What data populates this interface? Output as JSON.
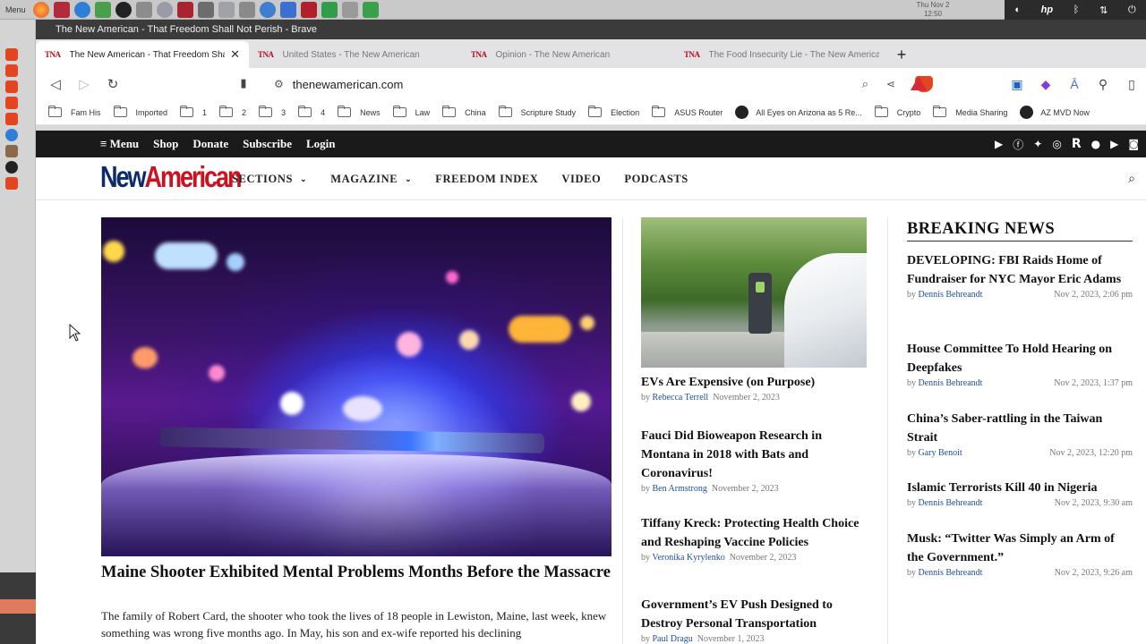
{
  "os": {
    "menu_label": "Menu",
    "clock_day": "Thu Nov 2",
    "clock_time": "12:50"
  },
  "window": {
    "title": "The New American - That Freedom Shall Not Perish - Brave"
  },
  "tabs": [
    {
      "label": "The New American - That Freedom Shall Not Perish - Brave",
      "active": true
    },
    {
      "label": "United States - The New American",
      "active": false
    },
    {
      "label": "Opinion - The New American",
      "active": false
    },
    {
      "label": "The Food Insecurity Lie - The New American",
      "active": false
    }
  ],
  "tab_favicon": "TNA",
  "address_bar": {
    "url": "thenewamerican.com"
  },
  "bookmarks": [
    {
      "label": "Fam His",
      "type": "folder"
    },
    {
      "label": "Imported",
      "type": "folder"
    },
    {
      "label": "1",
      "type": "folder"
    },
    {
      "label": "2",
      "type": "folder"
    },
    {
      "label": "3",
      "type": "folder"
    },
    {
      "label": "4",
      "type": "folder"
    },
    {
      "label": "News",
      "type": "folder"
    },
    {
      "label": "Law",
      "type": "folder"
    },
    {
      "label": "China",
      "type": "folder"
    },
    {
      "label": "Scripture Study",
      "type": "folder"
    },
    {
      "label": "Election",
      "type": "folder"
    },
    {
      "label": "ASUS Router",
      "type": "folder"
    },
    {
      "label": "All Eyes on Arizona as 5 Re...",
      "type": "site"
    },
    {
      "label": "Crypto",
      "type": "folder"
    },
    {
      "label": "Media Sharing",
      "type": "folder"
    },
    {
      "label": "AZ MVD Now",
      "type": "site"
    }
  ],
  "site": {
    "topbar_links": [
      "≡ Menu",
      "Shop",
      "Donate",
      "Subscribe",
      "Login"
    ],
    "logo_part1": "New",
    "logo_part2": "American",
    "nav": [
      {
        "label": "SECTIONS",
        "dropdown": true
      },
      {
        "label": "MAGAZINE",
        "dropdown": true
      },
      {
        "label": "FREEDOM INDEX",
        "dropdown": false
      },
      {
        "label": "VIDEO",
        "dropdown": false
      },
      {
        "label": "PODCASTS",
        "dropdown": false
      }
    ],
    "social_icons": [
      "rumble-icon",
      "facebook-icon",
      "twitter-icon",
      "instagram-icon",
      "r-icon",
      "apple-icon",
      "play-icon",
      "rss-icon"
    ]
  },
  "hero": {
    "title": "Maine Shooter Exhibited Mental Problems Months Before the Massacre",
    "text": "The family of Robert Card, the shooter who took the lives of 18 people in Lewiston, Maine, last week, knew something was wrong five months ago. In May, his son and ex-wife reported his declining"
  },
  "middle_articles": [
    {
      "title": "EVs Are Expensive (on Purpose)",
      "by": "by",
      "author": "Rebecca Terrell",
      "date": "November 2, 2023"
    },
    {
      "title": "Fauci Did Bioweapon Research in Montana in 2018 with Bats and Coronavirus!",
      "by": "by",
      "author": "Ben Armstrong",
      "date": "November 2, 2023"
    },
    {
      "title": "Tiffany Kreck: Protecting Health Choice and Reshaping Vaccine Policies",
      "by": "by",
      "author": "Veronika Kyrylenko",
      "date": "November 2, 2023"
    },
    {
      "title": "Government’s EV Push Designed to Destroy Personal Transportation",
      "by": "by",
      "author": "Paul Dragu",
      "date": "November 1, 2023"
    }
  ],
  "breaking": {
    "heading": "BREAKING NEWS",
    "items": [
      {
        "title": "DEVELOPING: FBI Raids Home of Fundraiser for NYC Mayor Eric Adams",
        "by": "by",
        "author": "Dennis Behreandt",
        "date": "Nov 2, 2023, 2:06 pm"
      },
      {
        "title": "House Committee To Hold Hearing on Deepfakes",
        "by": "by",
        "author": "Dennis Behreandt",
        "date": "Nov 2, 2023, 1:37 pm"
      },
      {
        "title": "China’s Saber-rattling in the Taiwan Strait",
        "by": "by",
        "author": "Gary Benoit",
        "date": "Nov 2, 2023, 12:20 pm"
      },
      {
        "title": "Islamic Terrorists Kill 40 in Nigeria",
        "by": "by",
        "author": "Dennis Behreandt",
        "date": "Nov 2, 2023, 9:30 am"
      },
      {
        "title": "Musk: “Twitter Was Simply an Arm of the Government.”",
        "by": "by",
        "author": "Dennis Behreandt",
        "date": "Nov 2, 2023, 9:26 am"
      }
    ]
  },
  "colors": {
    "logo_blue": "#0d2b6b",
    "logo_red": "#d0101e",
    "author_link": "#1d4fa0",
    "site_topbar": "#1a1a1a"
  }
}
